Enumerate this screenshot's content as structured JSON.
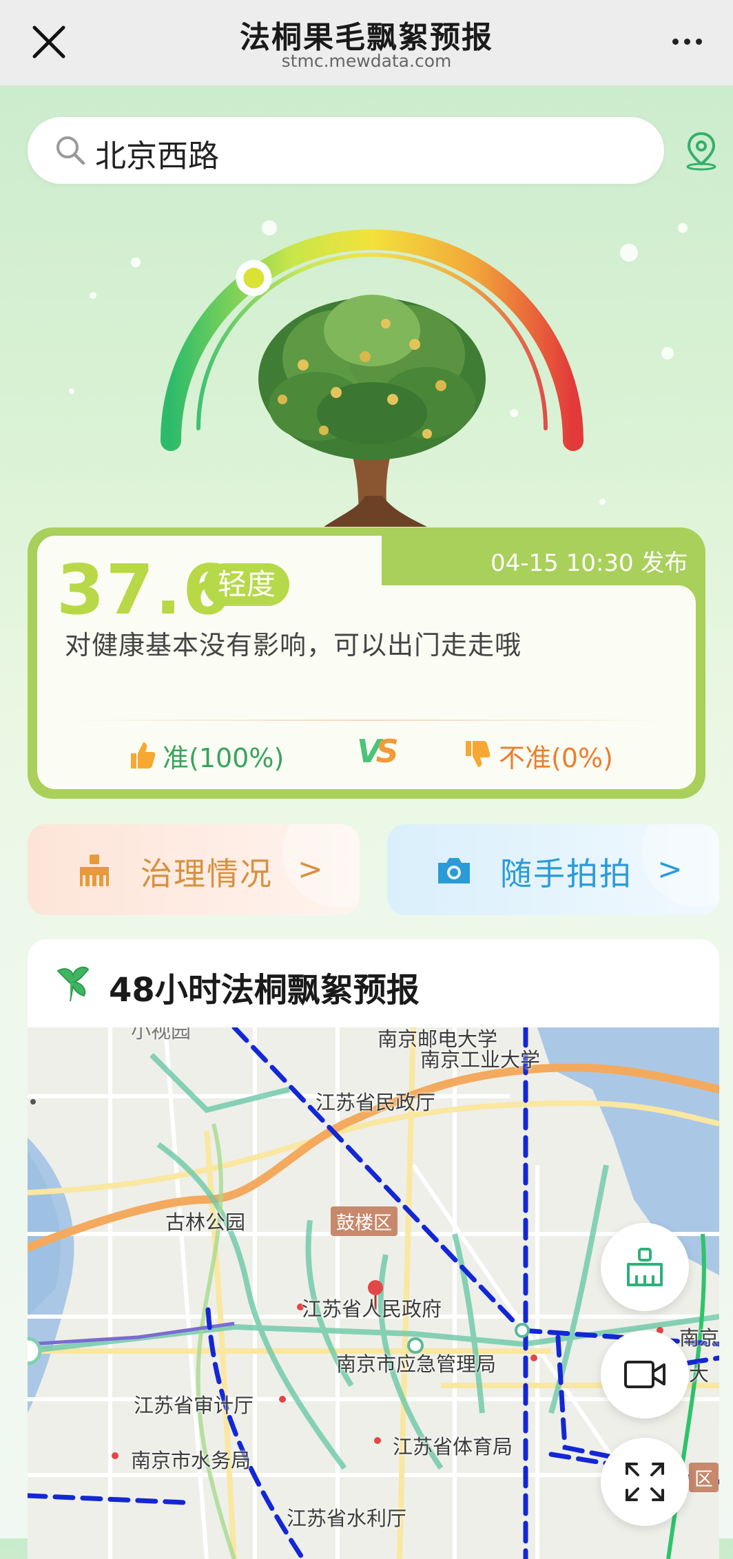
{
  "header": {
    "title": "法桐果毛飘絮预报",
    "domain": "stmc.mewdata.com"
  },
  "search": {
    "value": "北京西路"
  },
  "index": {
    "value": "37.6",
    "level": "轻度",
    "published": "04-15 10:30 发布",
    "advice": "对健康基本没有影响，可以出门走走哦",
    "gauge_level": 0.3
  },
  "votes": {
    "accurate": "准(100%)",
    "vs": "VS",
    "inaccurate": "不准(0%)"
  },
  "actions": {
    "governance": "治理情况",
    "photo": "随手拍拍",
    "chevron": ">"
  },
  "forecast": {
    "title": "48小时法桐飘絮预报"
  },
  "map": {
    "labels": {
      "nupt": "南京邮电大学",
      "njtech": "南京工业大学",
      "civil_affairs": "江苏省民政厅",
      "gulin_park": "古林公园",
      "gulou": "鼓楼区",
      "gov": "江苏省人民政府",
      "emergency": "南京市应急管理局",
      "audit": "江苏省审计厅",
      "sports": "江苏省体育局",
      "water": "南京市水务局",
      "water_resources": "江苏省水利厅",
      "nanjing_cut": "南京",
      "tianda_cut": "大",
      "district_cut": "区",
      "top_cut": "小视园"
    }
  },
  "colors": {
    "accent_green": "#a9d05b",
    "level_badge": "#b6d94a",
    "accurate": "#38a35c",
    "inaccurate": "#ef7d2b",
    "route": "#1327d6"
  }
}
